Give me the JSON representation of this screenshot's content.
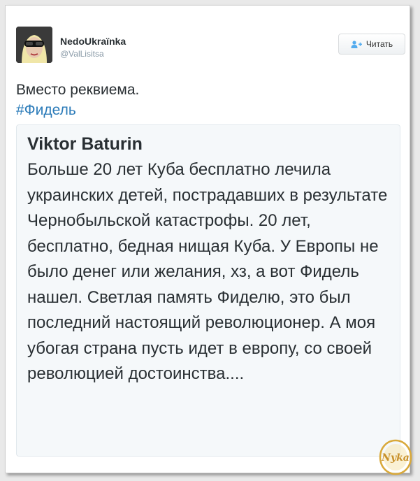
{
  "author": {
    "name": "NedoUkraїnka",
    "handle": "@ValLisitsa"
  },
  "follow_button": {
    "label": "Читать",
    "icon": "add-user-icon"
  },
  "tweet": {
    "text": "Вместо реквиема.",
    "hashtag": "#Фидель"
  },
  "quoted": {
    "author": "Viktor Baturin",
    "text": "Больше 20 лет Куба бесплатно лечила украинских детей, пострадавших в результате Чернобыльской катастрофы. 20 лет, бесплатно, бедная нищая Куба. У Европы не было денег или желания, хз, а вот Фидель нашел. Светлая память Фиделю, это был последний настоящий революционер. А моя убогая страна пусть идет в европу, со своей революцией достоинства...."
  },
  "watermark": {
    "text": "Nyka"
  },
  "colors": {
    "link": "#2b7bb9",
    "text": "#292f33",
    "muted": "#8899a6",
    "quote_bg": "#f5f8fa",
    "watermark": "#d9a93a"
  }
}
